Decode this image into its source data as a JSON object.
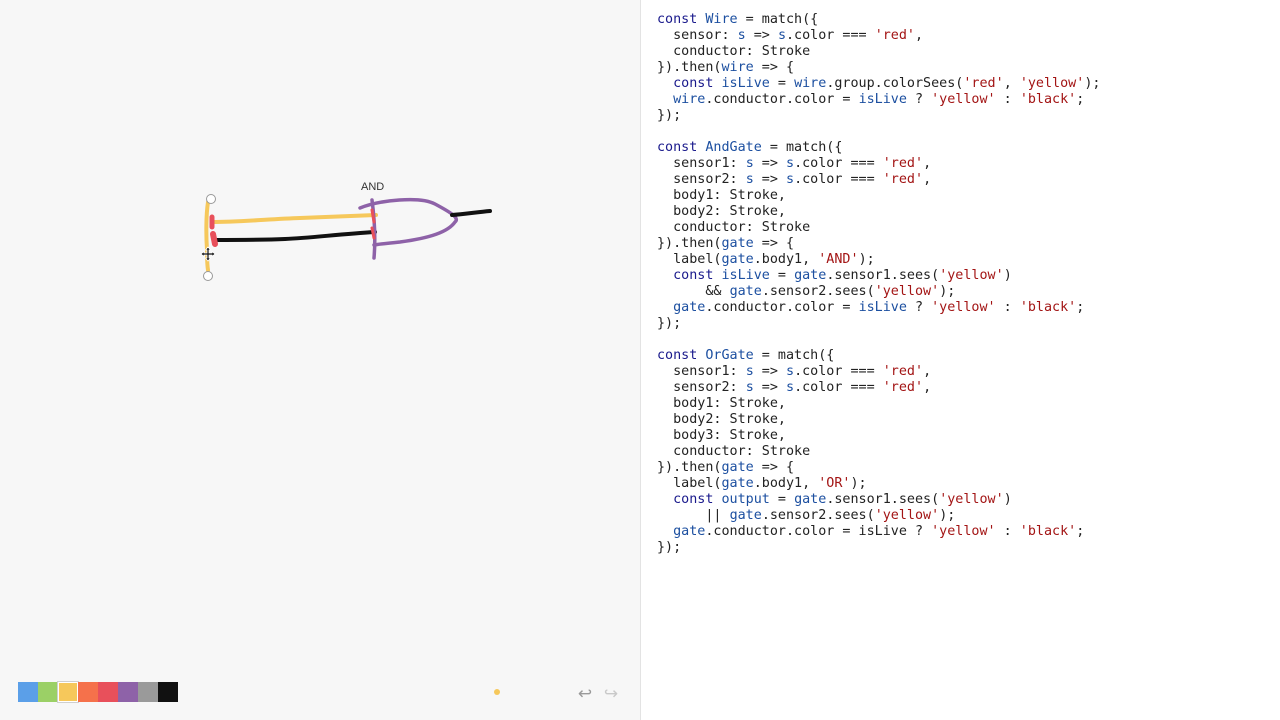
{
  "canvas": {
    "gate_label": "AND",
    "ink_colors": {
      "yellow": "#f6c85b",
      "black": "#111111",
      "purple": "#8e62a8",
      "red": "#e8505b"
    }
  },
  "palette": {
    "swatches": [
      {
        "name": "blue",
        "color": "#5b9fe8"
      },
      {
        "name": "green",
        "color": "#9bd066"
      },
      {
        "name": "yellow",
        "color": "#f6c85b",
        "selected": true
      },
      {
        "name": "orange",
        "color": "#f5714b"
      },
      {
        "name": "red",
        "color": "#e8505b"
      },
      {
        "name": "purple",
        "color": "#8e62a8"
      },
      {
        "name": "gray",
        "color": "#9a9a9a"
      },
      {
        "name": "black",
        "color": "#111111"
      }
    ],
    "current_color": "#f6c85b"
  },
  "toolbar": {
    "undo_icon": "↩",
    "redo_icon": "↪"
  },
  "code_lines": [
    [
      [
        "kw",
        "const "
      ],
      [
        "vr",
        "Wire"
      ],
      [
        "t",
        " = match({"
      ]
    ],
    [
      [
        "t",
        "  sensor: "
      ],
      [
        "vr",
        "s"
      ],
      [
        "t",
        " => "
      ],
      [
        "vr",
        "s"
      ],
      [
        "t",
        ".color === "
      ],
      [
        "st",
        "'red'"
      ],
      [
        "t",
        ","
      ]
    ],
    [
      [
        "t",
        "  conductor: Stroke"
      ]
    ],
    [
      [
        "t",
        "}).then("
      ],
      [
        "vr",
        "wire"
      ],
      [
        "t",
        " => {"
      ]
    ],
    [
      [
        "t",
        "  "
      ],
      [
        "kw",
        "const "
      ],
      [
        "vr",
        "isLive"
      ],
      [
        "t",
        " = "
      ],
      [
        "vr",
        "wire"
      ],
      [
        "t",
        ".group.colorSees("
      ],
      [
        "st",
        "'red'"
      ],
      [
        "t",
        ", "
      ],
      [
        "st",
        "'yellow'"
      ],
      [
        "t",
        ");"
      ]
    ],
    [
      [
        "t",
        "  "
      ],
      [
        "vr",
        "wire"
      ],
      [
        "t",
        ".conductor.color = "
      ],
      [
        "vr",
        "isLive"
      ],
      [
        "t",
        " ? "
      ],
      [
        "st",
        "'yellow'"
      ],
      [
        "t",
        " : "
      ],
      [
        "st",
        "'black'"
      ],
      [
        "t",
        ";"
      ]
    ],
    [
      [
        "t",
        "});"
      ]
    ],
    [
      [
        "t",
        ""
      ]
    ],
    [
      [
        "kw",
        "const "
      ],
      [
        "vr",
        "AndGate"
      ],
      [
        "t",
        " = match({"
      ]
    ],
    [
      [
        "t",
        "  sensor1: "
      ],
      [
        "vr",
        "s"
      ],
      [
        "t",
        " => "
      ],
      [
        "vr",
        "s"
      ],
      [
        "t",
        ".color === "
      ],
      [
        "st",
        "'red'"
      ],
      [
        "t",
        ","
      ]
    ],
    [
      [
        "t",
        "  sensor2: "
      ],
      [
        "vr",
        "s"
      ],
      [
        "t",
        " => "
      ],
      [
        "vr",
        "s"
      ],
      [
        "t",
        ".color === "
      ],
      [
        "st",
        "'red'"
      ],
      [
        "t",
        ","
      ]
    ],
    [
      [
        "t",
        "  body1: Stroke,"
      ]
    ],
    [
      [
        "t",
        "  body2: Stroke,"
      ]
    ],
    [
      [
        "t",
        "  conductor: Stroke"
      ]
    ],
    [
      [
        "t",
        "}).then("
      ],
      [
        "vr",
        "gate"
      ],
      [
        "t",
        " => {"
      ]
    ],
    [
      [
        "t",
        "  label("
      ],
      [
        "vr",
        "gate"
      ],
      [
        "t",
        ".body1, "
      ],
      [
        "st",
        "'AND'"
      ],
      [
        "t",
        ");"
      ]
    ],
    [
      [
        "t",
        "  "
      ],
      [
        "kw",
        "const "
      ],
      [
        "vr",
        "isLive"
      ],
      [
        "t",
        " = "
      ],
      [
        "vr",
        "gate"
      ],
      [
        "t",
        ".sensor1.sees("
      ],
      [
        "st",
        "'yellow'"
      ],
      [
        "t",
        ")"
      ]
    ],
    [
      [
        "t",
        "      && "
      ],
      [
        "vr",
        "gate"
      ],
      [
        "t",
        ".sensor2.sees("
      ],
      [
        "st",
        "'yellow'"
      ],
      [
        "t",
        ");"
      ]
    ],
    [
      [
        "t",
        "  "
      ],
      [
        "vr",
        "gate"
      ],
      [
        "t",
        ".conductor.color = "
      ],
      [
        "vr",
        "isLive"
      ],
      [
        "t",
        " ? "
      ],
      [
        "st",
        "'yellow'"
      ],
      [
        "t",
        " : "
      ],
      [
        "st",
        "'black'"
      ],
      [
        "t",
        ";"
      ]
    ],
    [
      [
        "t",
        "});"
      ]
    ],
    [
      [
        "t",
        ""
      ]
    ],
    [
      [
        "kw",
        "const "
      ],
      [
        "vr",
        "OrGate"
      ],
      [
        "t",
        " = match({"
      ]
    ],
    [
      [
        "t",
        "  sensor1: "
      ],
      [
        "vr",
        "s"
      ],
      [
        "t",
        " => "
      ],
      [
        "vr",
        "s"
      ],
      [
        "t",
        ".color === "
      ],
      [
        "st",
        "'red'"
      ],
      [
        "t",
        ","
      ]
    ],
    [
      [
        "t",
        "  sensor2: "
      ],
      [
        "vr",
        "s"
      ],
      [
        "t",
        " => "
      ],
      [
        "vr",
        "s"
      ],
      [
        "t",
        ".color === "
      ],
      [
        "st",
        "'red'"
      ],
      [
        "t",
        ","
      ]
    ],
    [
      [
        "t",
        "  body1: Stroke,"
      ]
    ],
    [
      [
        "t",
        "  body2: Stroke,"
      ]
    ],
    [
      [
        "t",
        "  body3: Stroke,"
      ]
    ],
    [
      [
        "t",
        "  conductor: Stroke"
      ]
    ],
    [
      [
        "t",
        "}).then("
      ],
      [
        "vr",
        "gate"
      ],
      [
        "t",
        " => {"
      ]
    ],
    [
      [
        "t",
        "  label("
      ],
      [
        "vr",
        "gate"
      ],
      [
        "t",
        ".body1, "
      ],
      [
        "st",
        "'OR'"
      ],
      [
        "t",
        ");"
      ]
    ],
    [
      [
        "t",
        "  "
      ],
      [
        "kw",
        "const "
      ],
      [
        "vr",
        "output"
      ],
      [
        "t",
        " = "
      ],
      [
        "vr",
        "gate"
      ],
      [
        "t",
        ".sensor1.sees("
      ],
      [
        "st",
        "'yellow'"
      ],
      [
        "t",
        ")"
      ]
    ],
    [
      [
        "t",
        "      || "
      ],
      [
        "vr",
        "gate"
      ],
      [
        "t",
        ".sensor2.sees("
      ],
      [
        "st",
        "'yellow'"
      ],
      [
        "t",
        ");"
      ]
    ],
    [
      [
        "t",
        "  "
      ],
      [
        "vr",
        "gate"
      ],
      [
        "t",
        ".conductor.color = isLive ? "
      ],
      [
        "st",
        "'yellow'"
      ],
      [
        "t",
        " : "
      ],
      [
        "st",
        "'black'"
      ],
      [
        "t",
        ";"
      ]
    ],
    [
      [
        "t",
        "});"
      ]
    ]
  ]
}
